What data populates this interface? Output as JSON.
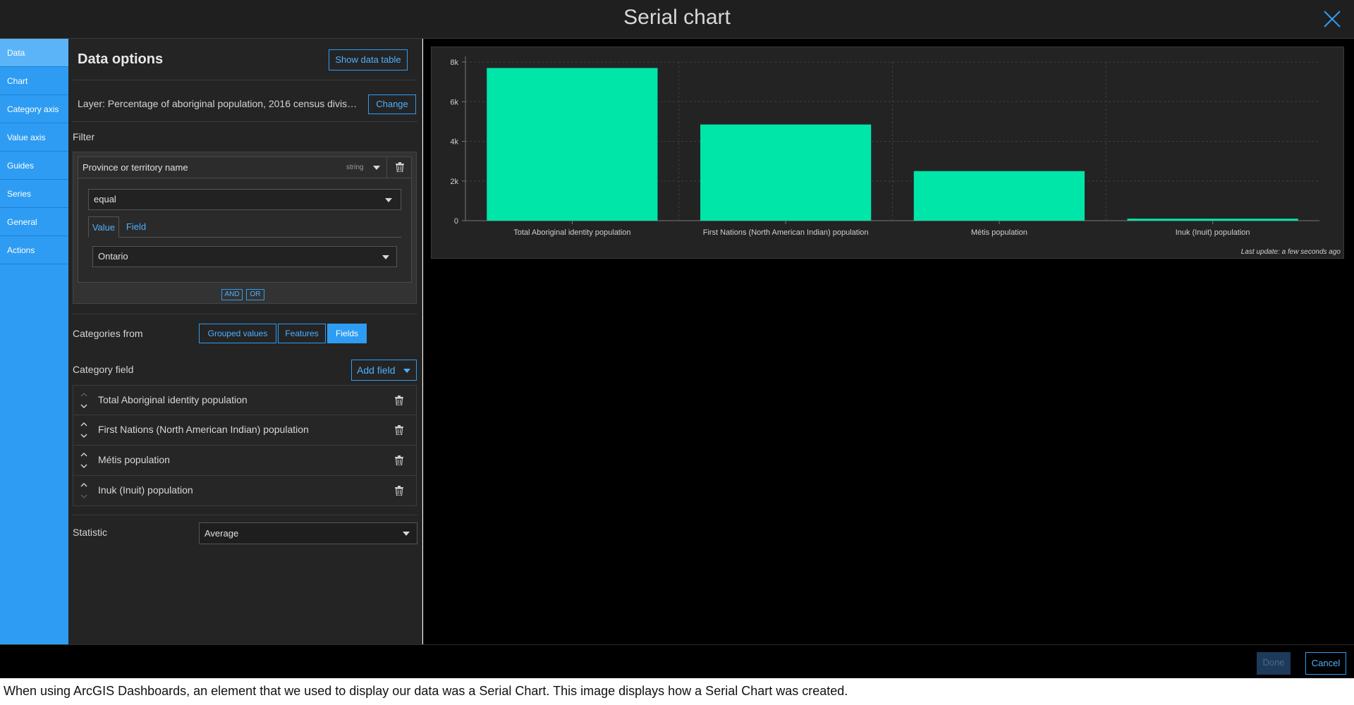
{
  "window": {
    "title": "Serial chart"
  },
  "sidebar": {
    "items": [
      {
        "label": "Data",
        "active": true
      },
      {
        "label": "Chart"
      },
      {
        "label": "Category axis"
      },
      {
        "label": "Value axis"
      },
      {
        "label": "Guides"
      },
      {
        "label": "Series"
      },
      {
        "label": "General"
      },
      {
        "label": "Actions"
      }
    ]
  },
  "panel": {
    "heading": "Data options",
    "show_table_label": "Show data table",
    "layer_text": "Layer: Percentage of aboriginal population, 2016 census divis…",
    "change_label": "Change",
    "filter": {
      "label": "Filter",
      "field": "Province or territory name",
      "field_type": "string",
      "operator": "equal",
      "tabs": [
        "Value",
        "Field"
      ],
      "value": "Ontario",
      "and_label": "AND",
      "or_label": "OR"
    },
    "categories_from": {
      "label": "Categories from",
      "options": [
        "Grouped values",
        "Features",
        "Fields"
      ],
      "selected": "Fields"
    },
    "category_field": {
      "label": "Category field",
      "add_label": "Add field",
      "items": [
        "Total Aboriginal identity population",
        "First Nations (North American Indian) population",
        "Métis population",
        "Inuk (Inuit) population"
      ]
    },
    "statistic": {
      "label": "Statistic",
      "value": "Average"
    }
  },
  "chart_data": {
    "type": "bar",
    "categories": [
      "Total Aboriginal identity population",
      "First Nations (North American Indian) population",
      "Métis population",
      "Inuk (Inuit) population"
    ],
    "values": [
      7700,
      4850,
      2500,
      100
    ],
    "yticks": [
      "0",
      "2k",
      "4k",
      "6k",
      "8k"
    ],
    "ylim": [
      0,
      8000
    ],
    "grid": true,
    "bar_color": "#00e6a8",
    "footnote": "Last update: a few seconds ago"
  },
  "footer": {
    "done_label": "Done",
    "cancel_label": "Cancel"
  },
  "caption": "When using ArcGIS Dashboards, an element that we used to display our data was a Serial Chart.  This image displays how a Serial Chart was created."
}
